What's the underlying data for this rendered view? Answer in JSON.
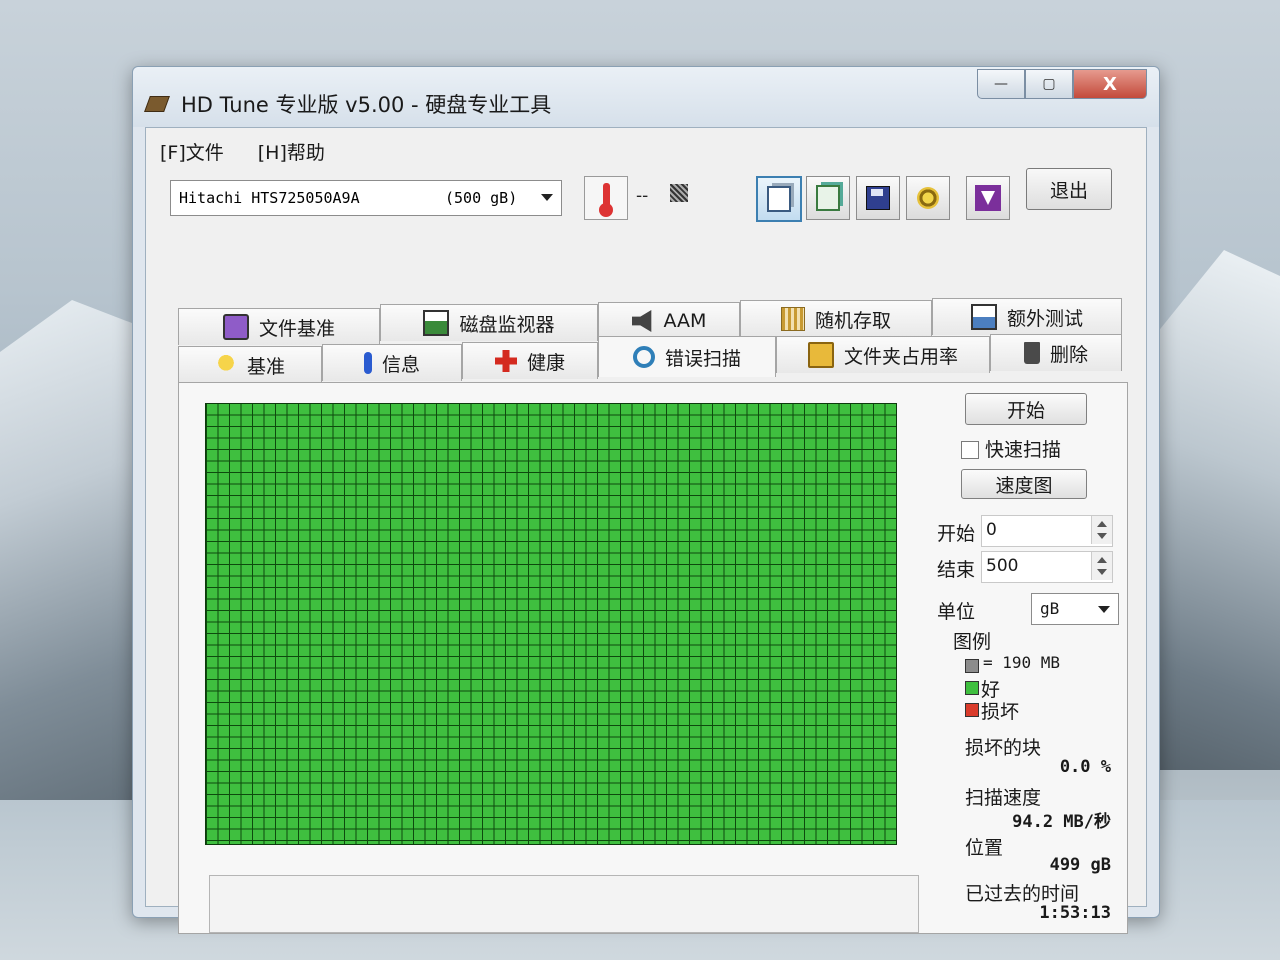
{
  "window": {
    "title": "HD Tune 专业版 v5.00 - 硬盘专业工具"
  },
  "window_buttons": {
    "minimize": "—",
    "maximize": "▢",
    "close": "X"
  },
  "menu": {
    "file": "[F]文件",
    "help": "[H]帮助"
  },
  "drive": {
    "name": "Hitachi HTS725050A9A",
    "size": "(500 gB)"
  },
  "temperature": {
    "value": "--"
  },
  "toolbar": {
    "exit": "退出"
  },
  "tabs": {
    "row_top": [
      "文件基准",
      "磁盘监视器",
      "AAM",
      "随机存取",
      "额外测试"
    ],
    "row_bottom": [
      "基准",
      "信息",
      "健康",
      "错误扫描",
      "文件夹占用率",
      "删除"
    ],
    "active": "错误扫描"
  },
  "scan": {
    "start_button": "开始",
    "quick_scan_label": "快速扫描",
    "quick_scan_checked": false,
    "speed_map_button": "速度图",
    "start_label": "开始",
    "start_value": "0",
    "end_label": "结束",
    "end_value": "500",
    "unit_label": "单位",
    "unit_value": "gB",
    "legend_title": "图例",
    "legend_block": "= 190 MB",
    "legend_good": "好",
    "legend_bad": "损坏",
    "damaged_blocks_label": "损坏的块",
    "damaged_blocks_value": "0.0 %",
    "scan_speed_label": "扫描速度",
    "scan_speed_value": "94.2 MB/秒",
    "position_label": "位置",
    "position_value": "499 gB",
    "elapsed_label": "已过去的时间",
    "elapsed_value": "1:53:13"
  },
  "colors": {
    "good": "#3fbf3f",
    "bad": "#d93b2b",
    "block": "#8c8c8c",
    "grid_line": "#0e4a0e"
  }
}
